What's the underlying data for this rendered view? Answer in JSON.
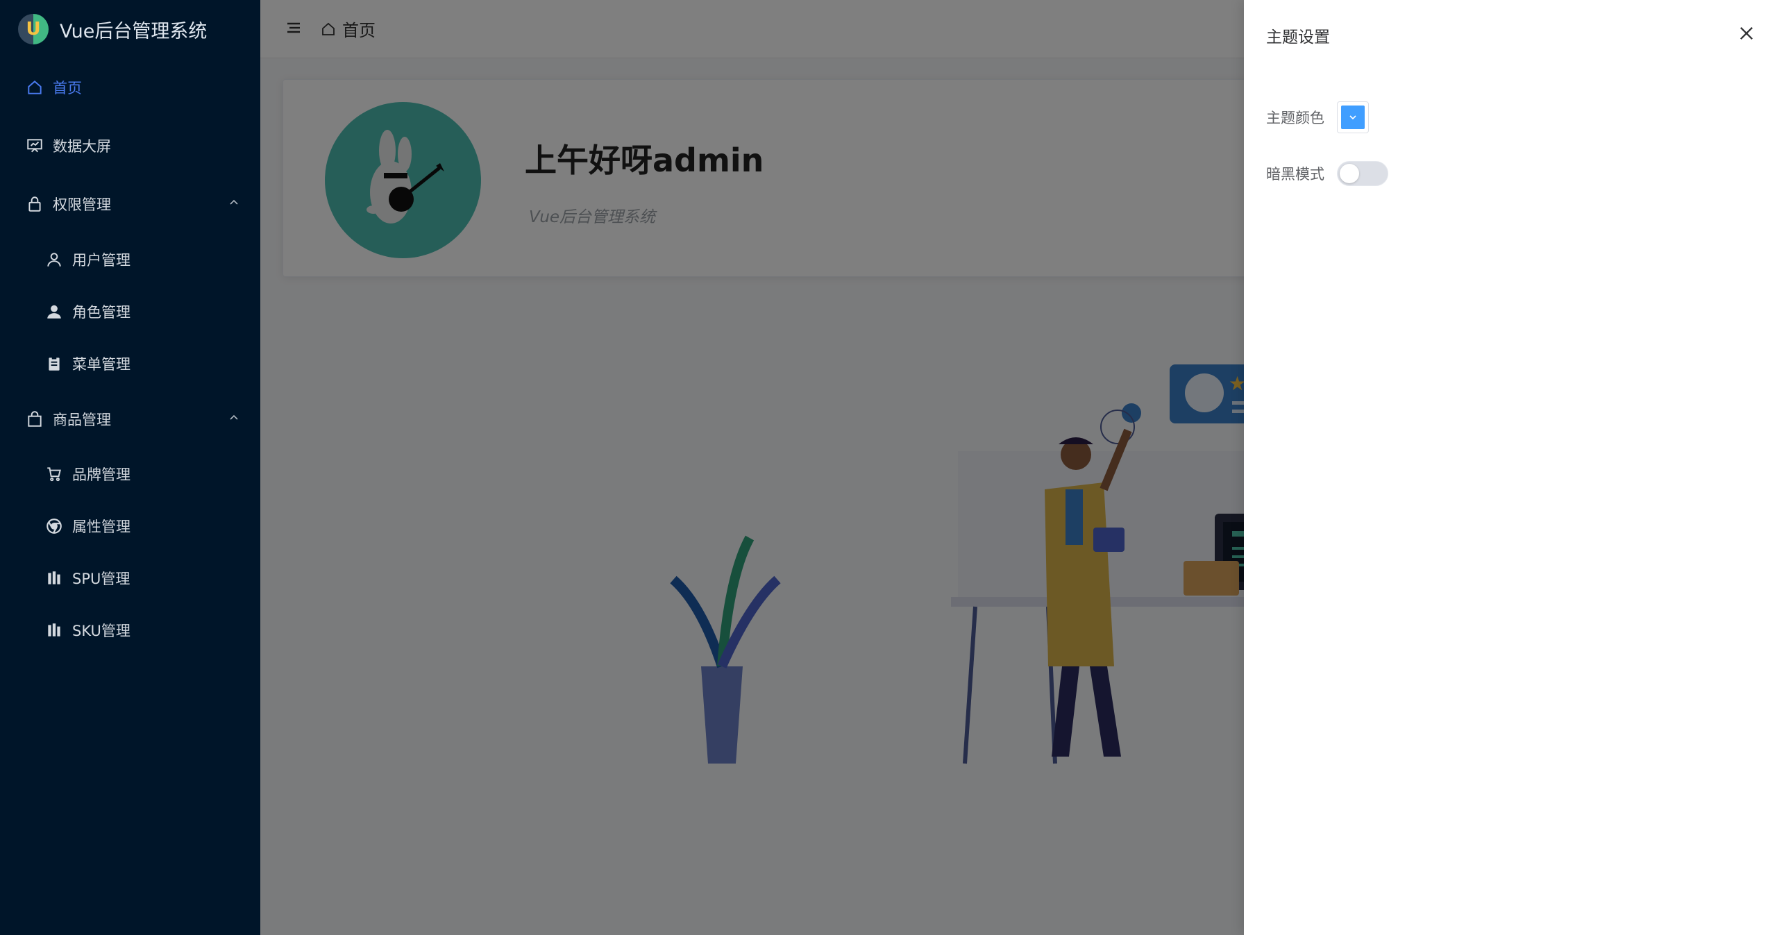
{
  "app": {
    "title": "Vue后台管理系统",
    "logo_letter": "U"
  },
  "sidebar": {
    "items": [
      {
        "label": "首页",
        "active": true
      },
      {
        "label": "数据大屏"
      },
      {
        "label": "权限管理",
        "expanded": true
      },
      {
        "label": "用户管理"
      },
      {
        "label": "角色管理"
      },
      {
        "label": "菜单管理"
      },
      {
        "label": "商品管理",
        "expanded": true
      },
      {
        "label": "品牌管理"
      },
      {
        "label": "属性管理"
      },
      {
        "label": "SPU管理"
      },
      {
        "label": "SKU管理"
      }
    ]
  },
  "topbar": {
    "breadcrumb": "首页"
  },
  "home": {
    "greeting": "上午好呀admin",
    "subtitle": "Vue后台管理系统"
  },
  "drawer": {
    "title": "主题设置",
    "color_label": "主题颜色",
    "theme_color": "#409eff",
    "dark_label": "暗黑模式",
    "dark_mode": false
  },
  "colors": {
    "sidebar_bg": "#001529",
    "active": "#4a7bf0",
    "avatar_bg": "#4dbdb0"
  }
}
